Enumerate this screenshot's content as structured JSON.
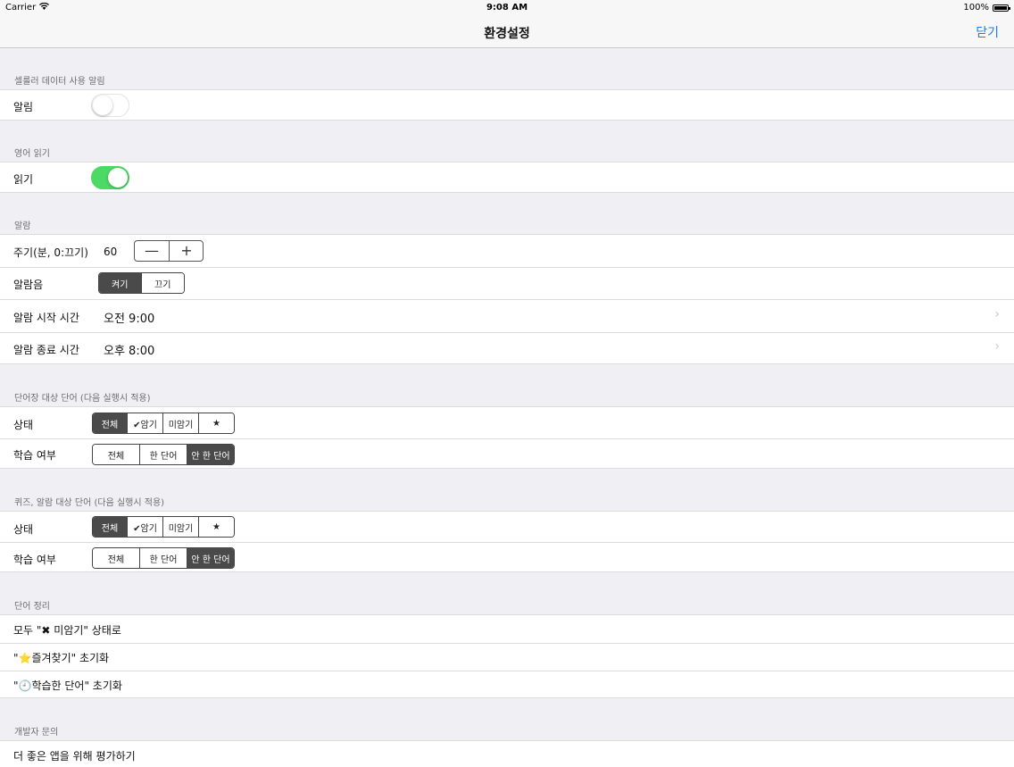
{
  "status": {
    "carrier": "Carrier",
    "time": "9:08 AM",
    "battery": "100%"
  },
  "nav": {
    "title": "환경설정",
    "close": "닫기"
  },
  "sections": {
    "cellular": {
      "header": "셀룰러 데이터 사용 알림",
      "label": "알림",
      "toggle": "off"
    },
    "english": {
      "header": "영어 읽기",
      "label": "읽기",
      "toggle": "on"
    },
    "alarm": {
      "header": "알람",
      "interval_label": "주기(분, 0:끄기)",
      "interval_value": "60",
      "minus": "—",
      "plus": "+",
      "sound_label": "알람음",
      "sound_options": [
        "켜기",
        "끄기"
      ],
      "sound_selected": "켜기",
      "start_label": "알람 시작 시간",
      "start_value": "오전 9:00",
      "end_label": "알람 종료 시간",
      "end_value": "오후 8:00"
    },
    "wordbook": {
      "header": "단어장 대상 단어 (다음 실행시 적용)",
      "state_label": "상태",
      "state_options": [
        "전체",
        "✔암기",
        "미암기",
        "★"
      ],
      "state_selected": "전체",
      "study_label": "학습 여부",
      "study_options": [
        "전체",
        "한 단어",
        "안 한 단어"
      ],
      "study_selected": "안 한 단어"
    },
    "quiz": {
      "header": "퀴즈, 알람 대상 단어 (다음 실행시 적용)",
      "state_label": "상태",
      "state_options": [
        "전체",
        "✔암기",
        "미암기",
        "★"
      ],
      "state_selected": "전체",
      "study_label": "학습 여부",
      "study_options": [
        "전체",
        "한 단어",
        "안 한 단어"
      ],
      "study_selected": "안 한 단어"
    },
    "cleanup": {
      "header": "단어 정리",
      "items": [
        "모두 \"✖ 미암기\" 상태로",
        "\"⭐즐겨찾기\" 초기화",
        "\"🕘학습한 단어\" 초기화"
      ]
    },
    "developer": {
      "header": "개발자 문의",
      "items": [
        "더 좋은 앱을 위해 평가하기"
      ]
    }
  },
  "colors": {
    "accent": "#1a7fe0",
    "toggle_on": "#4cd964",
    "segment_selected": "#4a4a4a"
  }
}
